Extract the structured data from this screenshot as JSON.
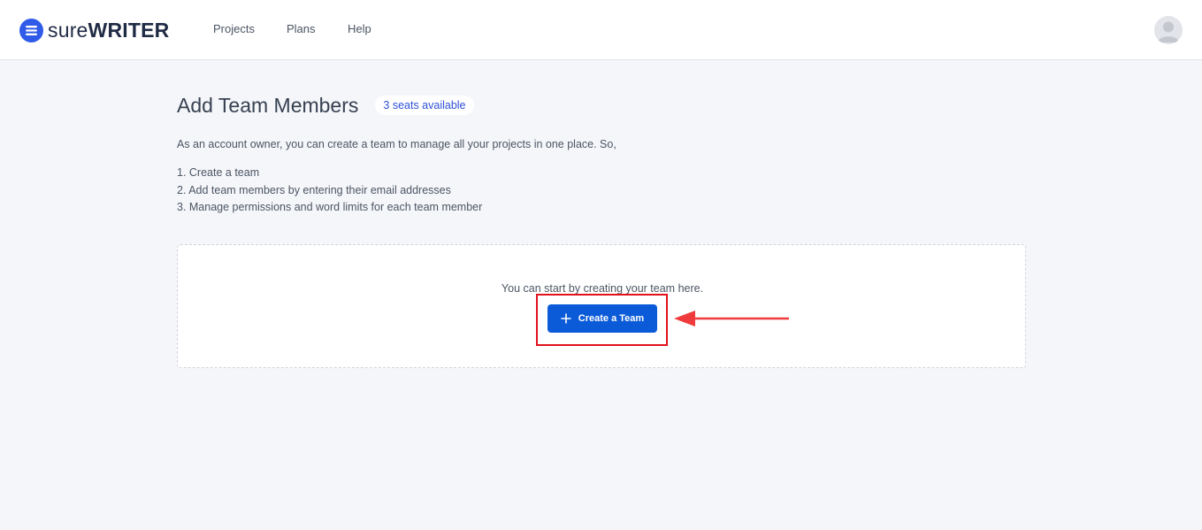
{
  "app": {
    "logo_text_light": "sure",
    "logo_text_bold": "WRITER",
    "brand_color": "#2f5be8"
  },
  "nav": {
    "items": [
      {
        "label": "Projects"
      },
      {
        "label": "Plans"
      },
      {
        "label": "Help"
      }
    ]
  },
  "user": {
    "avatar_icon": "user-avatar-icon"
  },
  "page": {
    "title": "Add Team Members",
    "seats_badge": "3 seats available",
    "intro": "As an account owner, you can create a team to manage all your projects in one place. So,",
    "steps": [
      "1. Create a team",
      "2. Add team members by entering their email addresses",
      "3. Manage permissions and word limits for each team member"
    ]
  },
  "team_box": {
    "hint": "You can start by creating your team here.",
    "create_button": "Create a Team",
    "button_icon": "plus-icon",
    "button_color": "#0b5bd8"
  },
  "annotation": {
    "highlight_color": "#e0121c",
    "arrow_color": "#ef3b3b"
  }
}
